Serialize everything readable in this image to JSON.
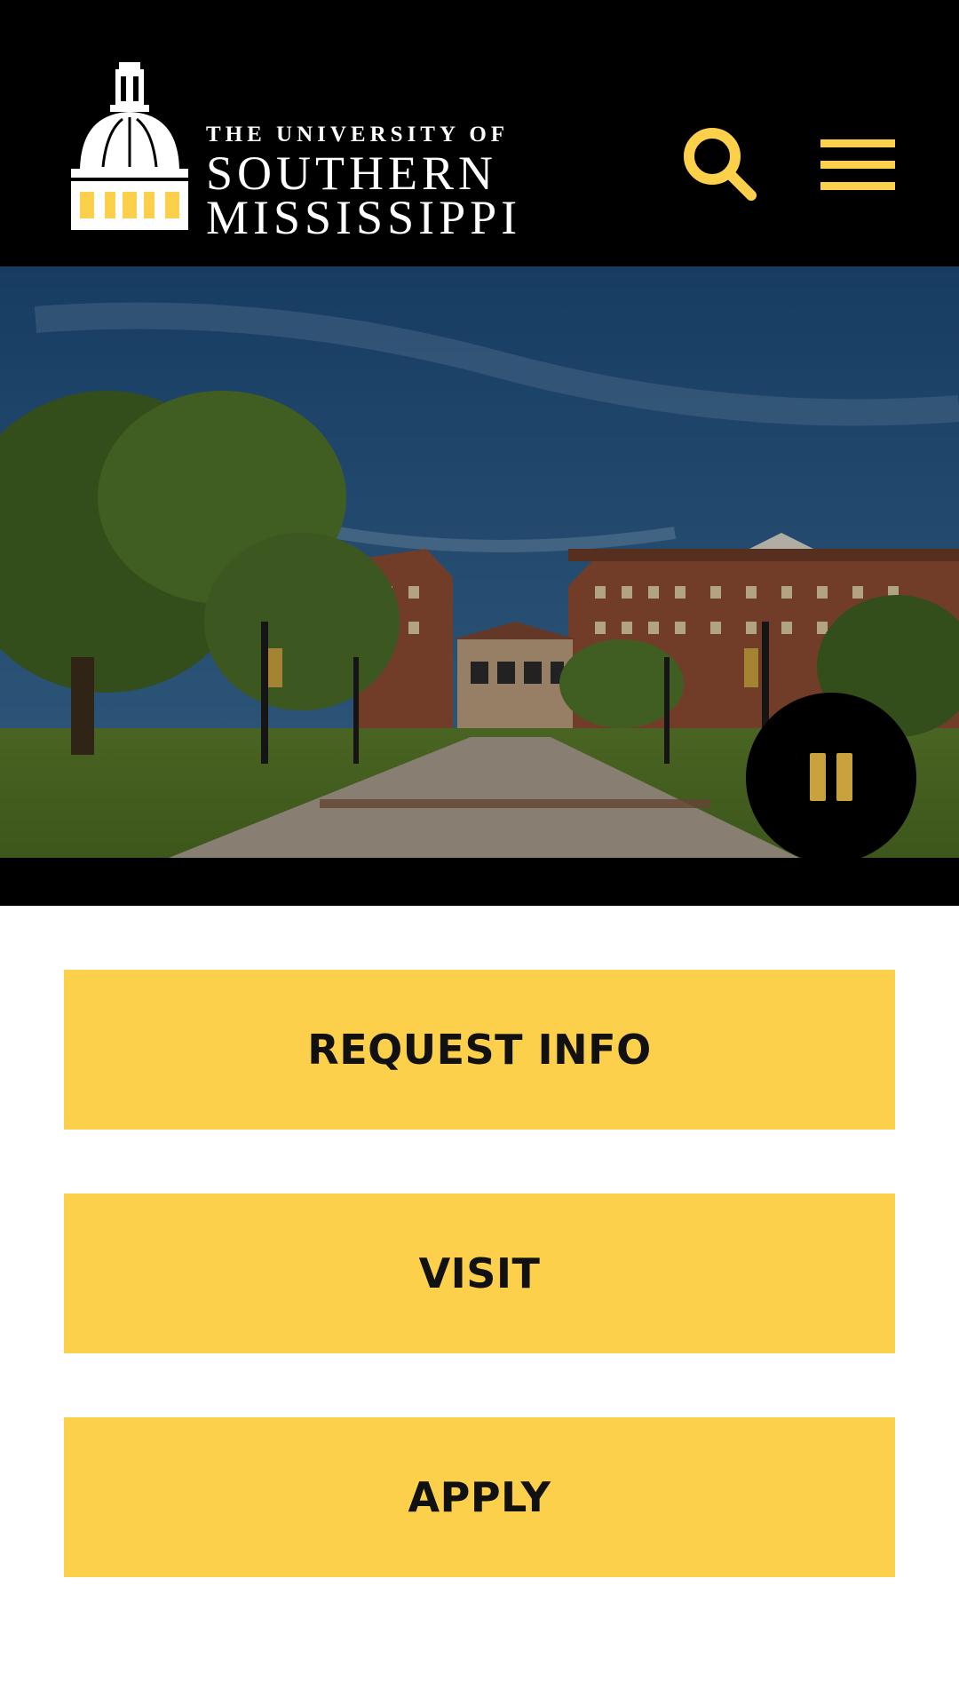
{
  "header": {
    "logo": {
      "line1": "THE UNIVERSITY OF",
      "line2": "SOUTHERN",
      "line3": "MISSISSIPPI"
    },
    "search_icon": "search-icon",
    "menu_icon": "hamburger-menu-icon",
    "accent_color": "#fcd04a"
  },
  "hero": {
    "pause_icon": "pause-icon"
  },
  "cta": {
    "request_info": "REQUEST INFO",
    "visit": "VISIT",
    "apply": "APPLY"
  },
  "colors": {
    "background_header": "#000000",
    "button_gold": "#fcd04a",
    "text_dark": "#111111"
  }
}
